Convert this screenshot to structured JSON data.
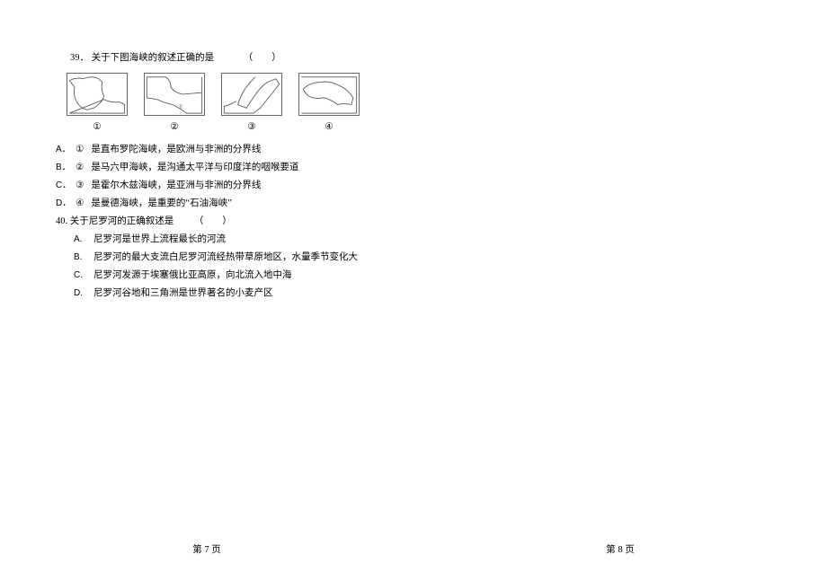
{
  "q39": {
    "number": "39．",
    "stem": "关于下图海峡的叙述正确的是",
    "paren": "（　　）",
    "map_labels": [
      "①",
      "②",
      "③",
      "④"
    ],
    "options": [
      {
        "label": "A．",
        "circle": "①",
        "text": "是直布罗陀海峡，是欧洲与非洲的分界线"
      },
      {
        "label": "B．",
        "circle": "②",
        "text": "是马六甲海峡，是沟通太平洋与印度洋的咽喉要道"
      },
      {
        "label": "C．",
        "circle": "③",
        "text": "是霍尔木兹海峡，是亚洲与非洲的分界线"
      },
      {
        "label": "D．",
        "circle": "④",
        "text": "是曼德海峡，是重要的“石油海峡”"
      }
    ]
  },
  "q40": {
    "number": "40.",
    "stem": "关于尼罗河的正确叙述是",
    "paren": "（　　）",
    "options": [
      {
        "label": "A.",
        "text": "尼罗河是世界上流程最长的河流"
      },
      {
        "label": "B.",
        "text": "尼罗河的最大支流白尼罗河流经热带草原地区，水量季节变化大"
      },
      {
        "label": "C.",
        "text": "尼罗河发源于埃塞俄比亚高原，向北流入地中海"
      },
      {
        "label": "D.",
        "text": "尼罗河谷地和三角洲是世界著名的小麦产区"
      }
    ]
  },
  "footer": {
    "left": "第 7 页",
    "right": "第 8 页"
  }
}
